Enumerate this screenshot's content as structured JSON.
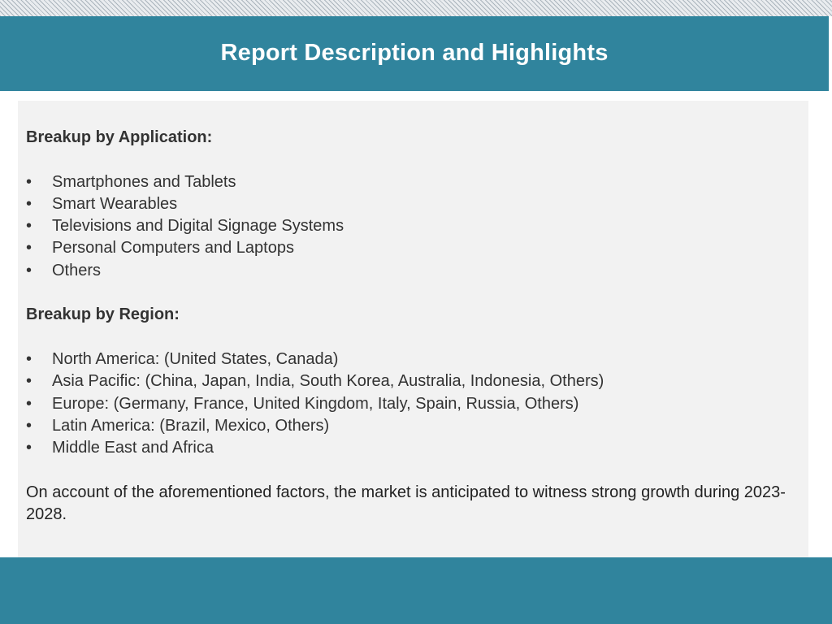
{
  "header": {
    "title": "Report Description and Highlights"
  },
  "content": {
    "application_heading": "Breakup by Application:",
    "application_items": [
      "Smartphones and Tablets",
      "Smart Wearables",
      "Televisions and Digital Signage Systems",
      "Personal Computers and Laptops",
      "Others"
    ],
    "region_heading": "Breakup by Region:",
    "region_items": [
      "North America: (United States, Canada)",
      "Asia Pacific: (China, Japan, India, South Korea, Australia, Indonesia, Others)",
      "Europe: (Germany, France, United Kingdom, Italy, Spain, Russia, Others)",
      "Latin America: (Brazil, Mexico, Others)",
      "Middle East and Africa"
    ],
    "bullet_glyph": "•",
    "closing_text": "On account of the aforementioned factors, the market is anticipated to witness strong growth during 2023-2028."
  },
  "colors": {
    "brand_teal": "#30849d",
    "panel_gray": "#f2f2f2",
    "text": "#333333"
  }
}
